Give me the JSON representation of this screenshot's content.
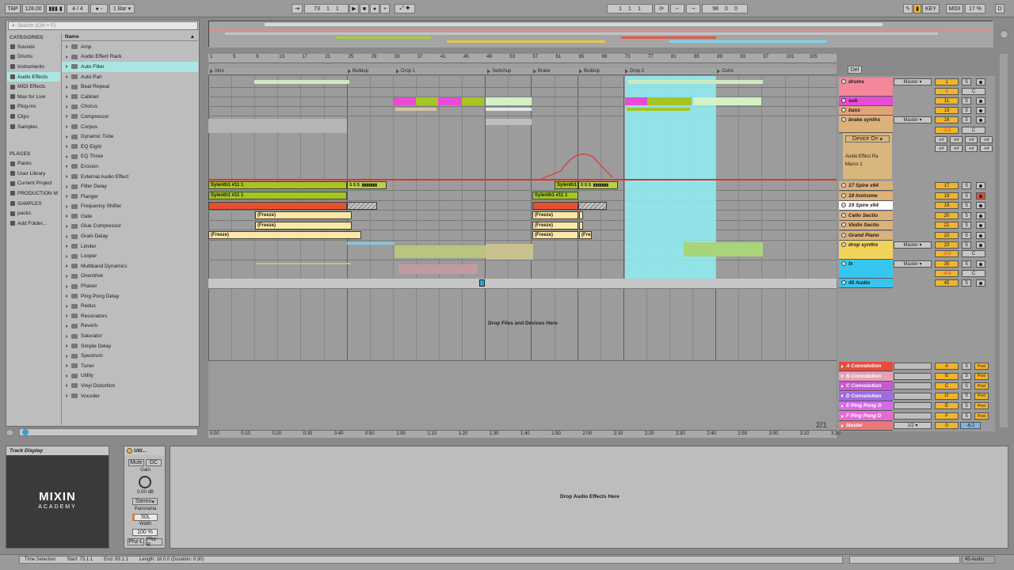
{
  "transport": {
    "tap": "TAP",
    "tempo": "128.00",
    "meter_num": "4",
    "meter_den": "4",
    "quantize": "1 Bar",
    "position": [
      "73",
      "1",
      "1"
    ],
    "loop_start": [
      "1",
      "1",
      "1"
    ],
    "loop_len": [
      "98",
      "0",
      "0"
    ],
    "key": "KEY",
    "midi": "MIDI",
    "cpu": "17 %",
    "disk": "D"
  },
  "browser": {
    "search_placeholder": "Search (Ctrl + F)",
    "categories_header": "CATEGORIES",
    "categories": [
      "Sounds",
      "Drums",
      "Instruments",
      "Audio Effects",
      "MIDI Effects",
      "Max for Live",
      "Plug-ins",
      "Clips",
      "Samples"
    ],
    "selected_category": "Audio Effects",
    "places_header": "PLACES",
    "places": [
      "Packs",
      "User Library",
      "Current Project",
      "PRODUCTION M",
      "SAMPLES",
      "packs",
      "Add Folder..."
    ],
    "name_header": "Name",
    "items": [
      "Amp",
      "Audio Effect Rack",
      "Auto Filter",
      "Auto Pan",
      "Beat Repeat",
      "Cabinet",
      "Chorus",
      "Compressor",
      "Corpus",
      "Dynamic Tube",
      "EQ Eight",
      "EQ Three",
      "Erosion",
      "External Audio Effect",
      "Filter Delay",
      "Flanger",
      "Frequency Shifter",
      "Gate",
      "Glue Compressor",
      "Grain Delay",
      "Limiter",
      "Looper",
      "Multiband Dynamics",
      "Overdrive",
      "Phaser",
      "Ping Pong Delay",
      "Redux",
      "Resonators",
      "Reverb",
      "Saturator",
      "Simple Delay",
      "Spectrum",
      "Tuner",
      "Utility",
      "Vinyl Distortion",
      "Vocoder"
    ],
    "selected_item": "Auto Filter"
  },
  "arrangement": {
    "bar_numbers": [
      "1",
      "5",
      "9",
      "13",
      "17",
      "21",
      "25",
      "29",
      "33",
      "37",
      "41",
      "45",
      "49",
      "53",
      "57",
      "61",
      "65",
      "69",
      "73",
      "77",
      "81",
      "85",
      "89",
      "93",
      "97",
      "101",
      "105"
    ],
    "locators": [
      "Intro",
      "Buildup",
      "Drop 1",
      "Switchup",
      "Brake",
      "Buildup",
      "Drop 2",
      "Outro"
    ],
    "time_ruler": [
      "0:00",
      "0:10",
      "0:20",
      "0:30",
      "0:40",
      "0:50",
      "1:00",
      "1:10",
      "1:20",
      "1:30",
      "1:40",
      "1:50",
      "2:00",
      "2:10",
      "2:20",
      "2:30",
      "2:40",
      "2:50",
      "3:00",
      "3:10",
      "3:20"
    ],
    "drop_zone": "Drop Files and Devices Here",
    "zoom": "2/1",
    "clips": {
      "sylenth_a": "Sylenth1 #11 1",
      "sylenth_b": "Sylenth1 #11 1",
      "sylenth_c": "Sylenth1 #11 1",
      "sylenth_d": "Sylenth1 #11 1",
      "freeze": "(Freeze)",
      "free": "(Free",
      "s": "S"
    }
  },
  "tracks": [
    {
      "name": "drums",
      "color": "#f4879a",
      "route": "Master",
      "num": "1"
    },
    {
      "name": "sub",
      "color": "#e84bd6",
      "route": "",
      "num": "11"
    },
    {
      "name": "bass",
      "color": "#e2a37a",
      "route": "",
      "num": "13"
    },
    {
      "name": "brake synths",
      "color": "#dcb17a",
      "route": "Master",
      "num": "16"
    },
    {
      "name": "17 Spire x64",
      "color": "#dcb17a",
      "route": "",
      "num": "17"
    },
    {
      "name": "18 Instrume",
      "color": "#dcb17a",
      "route": "",
      "num": "18"
    },
    {
      "name": "19 Spire x64",
      "color": "#ffffff",
      "route": "",
      "num": "19"
    },
    {
      "name": "Cello Sectio",
      "color": "#dcb17a",
      "route": "",
      "num": "20"
    },
    {
      "name": "Violin Sectio",
      "color": "#dcb17a",
      "route": "",
      "num": "21"
    },
    {
      "name": "Grand Piano",
      "color": "#dcb17a",
      "route": "",
      "num": "22"
    },
    {
      "name": "drop synths",
      "color": "#f2d35a",
      "route": "Master",
      "num": "23"
    },
    {
      "name": "fx",
      "color": "#36c6f0",
      "route": "Master",
      "num": "35"
    },
    {
      "name": "45 Audio",
      "color": "#36c6f0",
      "route": "",
      "num": "45"
    }
  ],
  "device_panel": {
    "device": "Device On",
    "rack": "Audio Effect Ra",
    "macro": "Macro 1",
    "neg_inf": "-inf",
    "vol_a": "0",
    "vol_b": "-2.5",
    "vol_c": "-2.0",
    "vol_d": "-4.9",
    "c": "C",
    "solo": "S"
  },
  "returns": [
    {
      "name": "A Convolution",
      "letter": "A",
      "color": "#e84a3c"
    },
    {
      "name": "B Convolution",
      "letter": "B",
      "color": "#e8a0b4"
    },
    {
      "name": "C Convolution",
      "letter": "C",
      "color": "#c65ad6"
    },
    {
      "name": "D Convolution",
      "letter": "D",
      "color": "#a06ae0"
    },
    {
      "name": "E Ping Pong D",
      "letter": "E",
      "color": "#d66ae8"
    },
    {
      "name": "F Ping Pong D",
      "letter": "F",
      "color": "#e66ad6"
    }
  ],
  "master": {
    "name": "Master",
    "route": "1/2",
    "num": "0",
    "vol": "-6.2",
    "post": "Post"
  },
  "track_display": {
    "title": "Track Display",
    "logo_top": "MIXIN",
    "logo_bottom": "ACADEMY"
  },
  "utility": {
    "title": "Util...",
    "mute": "Mute",
    "dc": "DC",
    "gain_label": "Gain",
    "gain_value": "0.00 dB",
    "stereo": "Stereo",
    "panorama": "Panorama",
    "pan_value": "50L",
    "width_label": "Width",
    "width_value": "100 %",
    "phz_l": "Phz-L",
    "phz_r": "Phz-R"
  },
  "device_drop": "Drop Audio Effects Here",
  "status": {
    "mode": "Time Selection",
    "start": "Start: 73.1.1",
    "end": "End: 89.1.1",
    "length": "Length: 18.0.0 (Duration: 0:30)",
    "track": "45-Audio"
  }
}
